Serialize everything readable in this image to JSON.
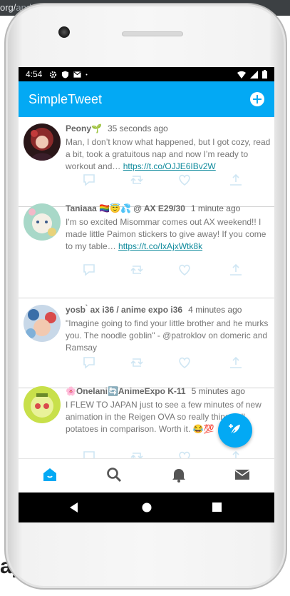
{
  "browser": {
    "url_prefix": "org/",
    "url_rest": "and"
  },
  "background_page": {
    "word": "ay"
  },
  "status_bar": {
    "time": "4:54",
    "icons": [
      "gear-icon",
      "shield-icon",
      "mail-icon",
      "dot-icon",
      "wifi-icon",
      "signal-icon",
      "battery-icon"
    ]
  },
  "app_bar": {
    "title": "SimpleTweet",
    "compose_icon": "add-circle-icon"
  },
  "tweets": [
    {
      "name": "Peony🌱",
      "handle": "",
      "timestamp": "35 seconds ago",
      "body": "Man, I don’t know what happened, but I got cozy, read a bit, took a gratuitous nap and now I’m ready to workout and… ",
      "link": "https://t.co/OJJE6IBv2W",
      "avatar_color": "#5a2a2a"
    },
    {
      "name": "Taniaaa 🏳️‍🌈😇💦 @ AX E29/30",
      "handle": "",
      "timestamp": "1 minute ago",
      "body": "I'm so excited Misommar comes out AX weekend!! I made little Paimon stickers to give away! If you come to my table… ",
      "link": "https://t.co/IxAjxWtk8k",
      "avatar_color": "#a8d8c8"
    },
    {
      "name": "yosb ̀ ax i36 / anime expo i36",
      "handle": "",
      "timestamp": "4 minutes ago",
      "body": "\"Imagine going to find your little brother and he murks you. The noodle goblin\" - @patroklov on domeric and Ramsay",
      "link": "",
      "avatar_color": "#7fb0d8"
    },
    {
      "name": "🌸Onelani🔄AnimeExpo K-11",
      "handle": "",
      "timestamp": "5 minutes ago",
      "body": "I FLEW TO JAPAN just to see a few minutes of new animation in the Reigen OVA so really things all potatoes in comparison. Worth it. 😂💯",
      "link": "",
      "avatar_color": "#c8e04a"
    }
  ],
  "tweet_actions": [
    "reply-icon",
    "retweet-icon",
    "like-icon",
    "share-icon"
  ],
  "bottom_nav": [
    "home-icon",
    "search-icon",
    "notifications-icon",
    "messages-icon"
  ],
  "fab": {
    "icon": "compose-feather-icon"
  },
  "colors": {
    "accent": "#03a9f4",
    "link": "#0f8a9c",
    "text": "#777777"
  }
}
